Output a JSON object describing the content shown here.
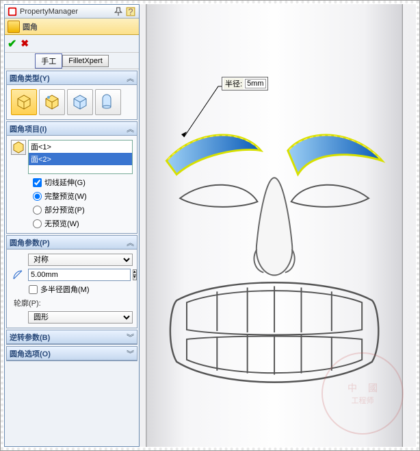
{
  "header": {
    "title": "PropertyManager"
  },
  "feature": {
    "title": "圆角"
  },
  "tabs": {
    "manual": "手工",
    "xpert": "FilletXpert"
  },
  "sections": {
    "type": {
      "title": "圆角类型(Y)"
    },
    "items": {
      "title": "圆角项目(I)",
      "faces": [
        "面<1>",
        "面<2>"
      ],
      "tangent": "切线延伸(G)",
      "full": "完整预览(W)",
      "partial": "部分预览(P)",
      "none": "无预览(W)"
    },
    "params": {
      "title": "圆角参数(P)",
      "symmetric": "对称",
      "radius": "5.00mm",
      "multi": "多半径圆角(M)",
      "profile_label": "轮廓(P):",
      "profile": "圆形"
    },
    "reverse": {
      "title": "逆转参数(B)"
    },
    "options": {
      "title": "圆角选项(O)"
    }
  },
  "callout": {
    "label": "半径:",
    "value": "5mm"
  },
  "watermark": {
    "top": "中國",
    "main": "工程师"
  }
}
